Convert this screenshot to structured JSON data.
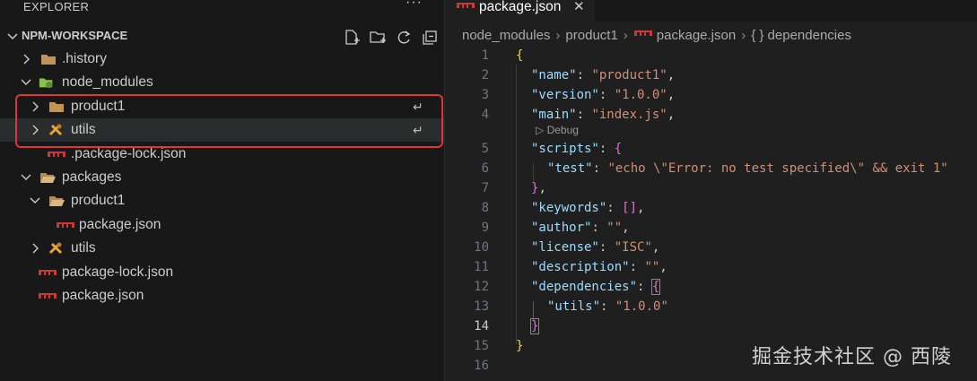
{
  "explorer": {
    "title": "EXPLORER",
    "more": "···"
  },
  "workspace": {
    "title": "NPM-WORKSPACE"
  },
  "tree": {
    "history": ".history",
    "node_modules": "node_modules",
    "product1": "product1",
    "utils": "utils",
    "package_lock_hidden": ".package-lock.json",
    "packages": "packages",
    "pkg_product1": "product1",
    "pkg_product1_json": "package.json",
    "pkg_utils": "utils",
    "root_package_lock": "package-lock.json",
    "root_package_json": "package.json",
    "link_glyph": "↵"
  },
  "editor": {
    "tab": {
      "label": "package.json",
      "close": "✕"
    },
    "breadcrumbs": [
      "node_modules",
      "product1",
      "package.json",
      "{ } dependencies"
    ],
    "codelens": "Debug",
    "lines": [
      {
        "n": "1",
        "t": "{"
      },
      {
        "n": "2",
        "t": "\"name\": \"product1\","
      },
      {
        "n": "3",
        "t": "\"version\": \"1.0.0\","
      },
      {
        "n": "4",
        "t": "\"main\": \"index.js\","
      },
      {
        "n": "5",
        "t": "\"scripts\": {"
      },
      {
        "n": "6",
        "t": "\"test\": \"echo \\\"Error: no test specified\\\" && exit 1\""
      },
      {
        "n": "7",
        "t": "},"
      },
      {
        "n": "8",
        "t": "\"keywords\": [],"
      },
      {
        "n": "9",
        "t": "\"author\": \"\","
      },
      {
        "n": "10",
        "t": "\"license\": \"ISC\","
      },
      {
        "n": "11",
        "t": "\"description\": \"\","
      },
      {
        "n": "12",
        "t": "\"dependencies\": {"
      },
      {
        "n": "13",
        "t": "\"utils\": \"1.0.0\""
      },
      {
        "n": "14",
        "t": "}"
      },
      {
        "n": "15",
        "t": "}"
      },
      {
        "n": "16",
        "t": ""
      }
    ]
  },
  "watermark": "掘金技术社区 @ 西陵"
}
